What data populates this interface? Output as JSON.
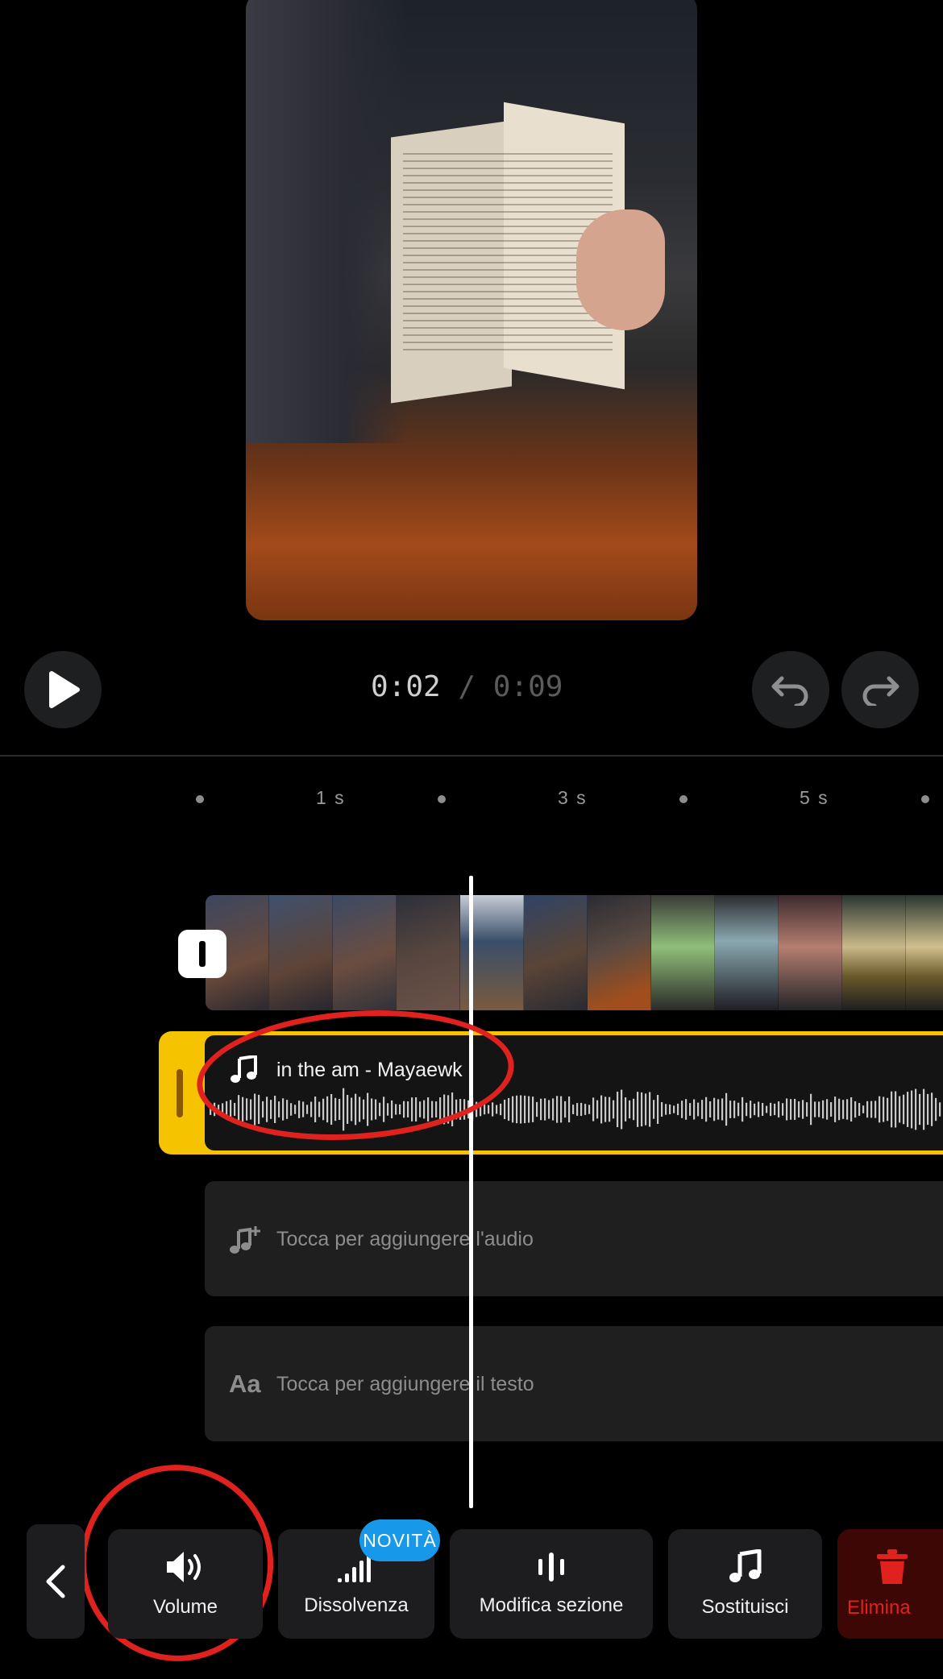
{
  "player": {
    "current_time": "0:02",
    "separator": "/",
    "total_time": "0:09"
  },
  "ruler": {
    "labels": [
      "1 s",
      "3 s",
      "5 s"
    ]
  },
  "audio_track": {
    "title": "in the am - Mayaewk"
  },
  "empty_tracks": {
    "audio_placeholder": "Tocca per aggiungere l'audio",
    "text_placeholder": "Tocca per aggiungere il testo",
    "text_icon": "Aa"
  },
  "toolbar": {
    "new_badge": "NOVITÀ",
    "items": [
      {
        "label": "Volume",
        "icon": "speaker-icon"
      },
      {
        "label": "Dissolvenza",
        "icon": "fade-bars-icon"
      },
      {
        "label": "Modifica sezione",
        "icon": "edit-section-icon"
      },
      {
        "label": "Sostituisci",
        "icon": "music-note-icon"
      },
      {
        "label": "Elimina",
        "icon": "trash-icon"
      }
    ]
  },
  "colors": {
    "accent_yellow": "#f6c300",
    "badge_blue": "#1798e8",
    "danger_red": "#e0221f",
    "annotation_red": "#e0221f"
  }
}
